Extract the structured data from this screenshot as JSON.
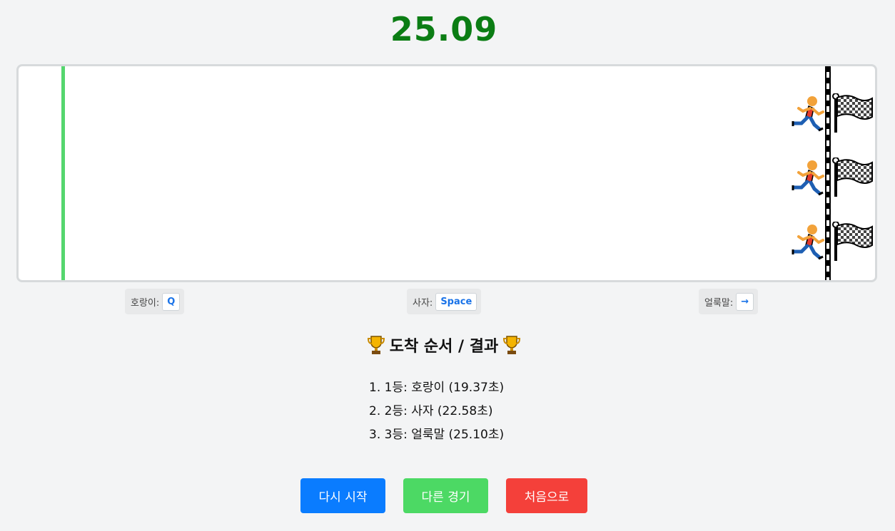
{
  "timer": "25.09",
  "colors": {
    "timer": "#0b7d14",
    "start_line": "#55d66e",
    "key_text": "#1a73e8",
    "btn_restart": "#0a7cff",
    "btn_other": "#4cd964",
    "btn_home": "#f4403a"
  },
  "lanes": [
    {
      "runner_icon": "running-person-icon",
      "flag_icon": "checkered-flag-icon"
    },
    {
      "runner_icon": "running-person-icon",
      "flag_icon": "checkered-flag-icon"
    },
    {
      "runner_icon": "running-person-icon",
      "flag_icon": "checkered-flag-icon"
    }
  ],
  "controls": [
    {
      "label": "호랑이:",
      "key": "Q"
    },
    {
      "label": "사자:",
      "key": "Space"
    },
    {
      "label": "얼룩말:",
      "key": "→"
    }
  ],
  "results": {
    "title": "도착 순서 / 결과",
    "icon": "trophy-icon",
    "items": [
      "1. 1등: 호랑이 (19.37초)",
      "2. 2등: 사자 (22.58초)",
      "3. 3등: 얼룩말 (25.10초)"
    ]
  },
  "buttons": {
    "restart": "다시 시작",
    "other_race": "다른 경기",
    "home": "처음으로"
  }
}
